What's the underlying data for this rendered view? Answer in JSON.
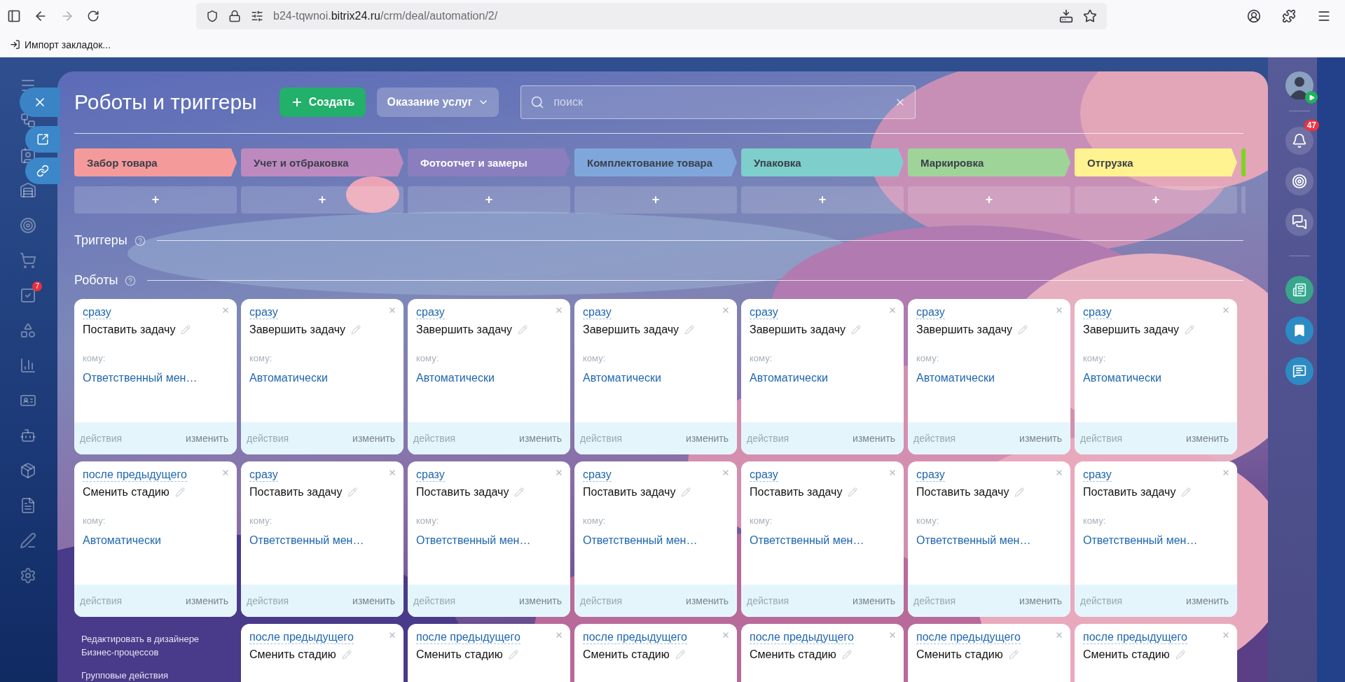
{
  "browser": {
    "url_parts": [
      "b24-tqwnoi.",
      "bitrix24.ru",
      "/crm/deal/automation/2/"
    ],
    "bookmark": "Импорт закладок..."
  },
  "left_nav": {
    "badge": "7"
  },
  "right_bar": {
    "notifications": "47"
  },
  "panel": {
    "title": "Роботы и триггеры",
    "create": "Создать",
    "category": "Оказание услуг",
    "search": {
      "placeholder": "поиск"
    }
  },
  "stages": [
    {
      "name": "Забор товара",
      "color": "#f59a9b",
      "add": "+"
    },
    {
      "name": "Учет и отбраковка",
      "color": "#bd8abf",
      "add": "+"
    },
    {
      "name": "Фотоотчет и замеры",
      "color": "#8a7ebf",
      "add": "+"
    },
    {
      "name": "Комплектование товара",
      "color": "#7fa7dc",
      "add": "+"
    },
    {
      "name": "Упаковка",
      "color": "#7ecfcb",
      "add": "+"
    },
    {
      "name": "Маркировка",
      "color": "#9fd499",
      "add": "+"
    },
    {
      "name": "Отгрузка",
      "color": "#fff290",
      "add": "+"
    },
    {
      "color": "#7ed321"
    }
  ],
  "triggers_heading": "Триггеры",
  "robots_heading": "Роботы",
  "robot_columns": [
    [
      {
        "delay": "сразу",
        "title": "Поставить задачу",
        "to_label": "кому:",
        "assignee": "Ответственный мен…",
        "actions": "действия",
        "edit": "изменить"
      },
      {
        "delay": "после предыдущего",
        "title": "Сменить стадию",
        "to_label": "кому:",
        "assignee": "Автоматически",
        "actions": "действия",
        "edit": "изменить"
      }
    ],
    [
      {
        "delay": "сразу",
        "title": "Завершить задачу",
        "to_label": "кому:",
        "assignee": "Автоматически",
        "actions": "действия",
        "edit": "изменить"
      },
      {
        "delay": "сразу",
        "title": "Поставить задачу",
        "to_label": "кому:",
        "assignee": "Ответственный мен…",
        "actions": "действия",
        "edit": "изменить"
      },
      {
        "delay": "после предыдущего",
        "title": "Сменить стадию"
      }
    ],
    [
      {
        "delay": "сразу",
        "title": "Завершить задачу",
        "to_label": "кому:",
        "assignee": "Автоматически",
        "actions": "действия",
        "edit": "изменить"
      },
      {
        "delay": "сразу",
        "title": "Поставить задачу",
        "to_label": "кому:",
        "assignee": "Ответственный мен…",
        "actions": "действия",
        "edit": "изменить"
      },
      {
        "delay": "после предыдущего",
        "title": "Сменить стадию"
      }
    ],
    [
      {
        "delay": "сразу",
        "title": "Завершить задачу",
        "to_label": "кому:",
        "assignee": "Автоматически",
        "actions": "действия",
        "edit": "изменить"
      },
      {
        "delay": "сразу",
        "title": "Поставить задачу",
        "to_label": "кому:",
        "assignee": "Ответственный мен…",
        "actions": "действия",
        "edit": "изменить"
      },
      {
        "delay": "после предыдущего",
        "title": "Сменить стадию"
      }
    ],
    [
      {
        "delay": "сразу",
        "title": "Завершить задачу",
        "to_label": "кому:",
        "assignee": "Автоматически",
        "actions": "действия",
        "edit": "изменить"
      },
      {
        "delay": "сразу",
        "title": "Поставить задачу",
        "to_label": "кому:",
        "assignee": "Ответственный мен…",
        "actions": "действия",
        "edit": "изменить"
      },
      {
        "delay": "после предыдущего",
        "title": "Сменить стадию"
      }
    ],
    [
      {
        "delay": "сразу",
        "title": "Завершить задачу",
        "to_label": "кому:",
        "assignee": "Автоматически",
        "actions": "действия",
        "edit": "изменить"
      },
      {
        "delay": "сразу",
        "title": "Поставить задачу",
        "to_label": "кому:",
        "assignee": "Ответственный мен…",
        "actions": "действия",
        "edit": "изменить"
      },
      {
        "delay": "после предыдущего",
        "title": "Сменить стадию"
      }
    ],
    [
      {
        "delay": "сразу",
        "title": "Завершить задачу",
        "to_label": "кому:",
        "assignee": "Автоматически",
        "actions": "действия",
        "edit": "изменить"
      },
      {
        "delay": "сразу",
        "title": "Поставить задачу",
        "to_label": "кому:",
        "assignee": "Ответственный мен…",
        "actions": "действия",
        "edit": "изменить"
      },
      {
        "delay": "после предыдущего",
        "title": "Сменить стадию"
      }
    ]
  ],
  "designer_links": [
    "Редактировать в дизайнере Бизнес-процессов",
    "Групповые действия"
  ]
}
